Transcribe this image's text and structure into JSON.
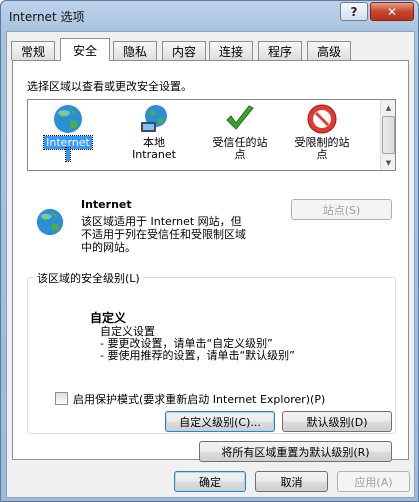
{
  "window": {
    "title": "Internet 选项",
    "help_glyph": "?",
    "close_glyph": "✕"
  },
  "tabs": [
    {
      "label": "常规"
    },
    {
      "label": "安全"
    },
    {
      "label": "隐私"
    },
    {
      "label": "内容"
    },
    {
      "label": "连接"
    },
    {
      "label": "程序"
    },
    {
      "label": "高级"
    }
  ],
  "security": {
    "select_zone_label": "选择区域以查看或更改安全设置。",
    "zones": [
      {
        "label_line1": "Internet",
        "label_line2": "",
        "icon": "globe-icon",
        "selected": true
      },
      {
        "label_line1": "本地",
        "label_line2": "Intranet",
        "icon": "intranet-globe-icon",
        "selected": false
      },
      {
        "label_line1": "受信任的站",
        "label_line2": "点",
        "icon": "checkmark-icon",
        "selected": false
      },
      {
        "label_line1": "受限制的站",
        "label_line2": "点",
        "icon": "restricted-icon",
        "selected": false
      }
    ],
    "zone_title": "Internet",
    "zone_desc_lines": [
      "该区域适用于 Internet 网站，但",
      "不适用于列在受信任和受限制区域",
      "中的网站。"
    ],
    "sites_button": "站点(S)",
    "level_group_title": "该区域的安全级别(L)",
    "custom_title": "自定义",
    "custom_lines": [
      "自定义设置",
      "- 要更改设置，请单击“自定义级别”",
      "- 要使用推荐的设置，请单击“默认级别”"
    ],
    "protected_mode_label": "启用保护模式(要求重新启动 Internet Explorer)(P)",
    "protected_mode_checked": false,
    "custom_level_button": "自定义级别(C)...",
    "default_level_button": "默认级别(D)",
    "reset_all_button": "将所有区域重置为默认级别(R)"
  },
  "footer": {
    "ok_button": "确定",
    "cancel_button": "取消",
    "apply_button": "应用(A)"
  },
  "colors": {
    "selection": "#3399ff",
    "close_red": "#c6452c",
    "title_gradient": "#bdd3ea"
  }
}
